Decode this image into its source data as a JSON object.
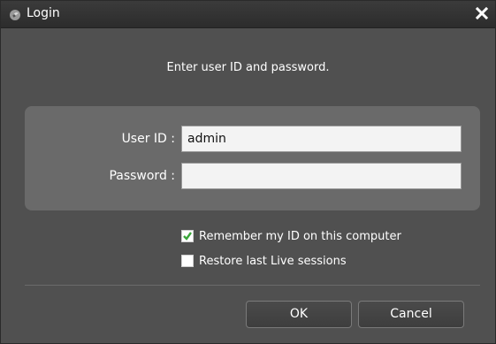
{
  "window": {
    "title": "Login",
    "icons": {
      "app": "app-logo-icon",
      "close": "close-icon"
    }
  },
  "dialog": {
    "instruction": "Enter user ID and password.",
    "fields": {
      "user_id": {
        "label": "User ID :",
        "value": "admin"
      },
      "password": {
        "label": "Password :",
        "value": ""
      }
    },
    "options": [
      {
        "label": "Remember my ID on this computer",
        "checked": true
      },
      {
        "label": "Restore last Live sessions",
        "checked": false
      }
    ],
    "buttons": {
      "ok": "OK",
      "cancel": "Cancel"
    }
  },
  "colors": {
    "titlebar": "#2c2c2c",
    "background": "#505050",
    "panel": "#6a6a6a",
    "checkmark": "#3aa63a"
  }
}
